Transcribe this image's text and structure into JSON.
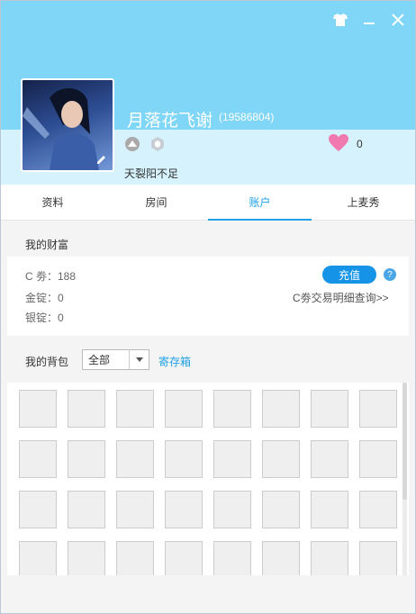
{
  "colors": {
    "accent": "#1ea1e6",
    "header": "#7fd6f7",
    "recharge": "#1593e6"
  },
  "profile": {
    "nickname": "月落花飞谢",
    "uid": "(19586804)",
    "heart_count": "0",
    "signature": "天裂阳不足"
  },
  "tabs": [
    {
      "label": "资料",
      "active": false
    },
    {
      "label": "房间",
      "active": false
    },
    {
      "label": "账户",
      "active": true
    },
    {
      "label": "上麦秀",
      "active": false
    }
  ],
  "wealth": {
    "title": "我的财富",
    "c_coupon": "C 劵：188",
    "gold": "金锭：0",
    "silver": "银锭：0",
    "recharge_label": "充值",
    "help_label": "?",
    "detail_link": "C劵交易明细查询>>"
  },
  "bag": {
    "title": "我的背包",
    "filter_value": "全部",
    "storage_link": "寄存箱",
    "slot_count": 32
  },
  "icons": [
    "shirt-icon",
    "minimize-icon",
    "close-icon",
    "edit-icon",
    "rank-badge-icon",
    "hex-badge-icon",
    "heart-icon",
    "chevron-down-icon"
  ]
}
